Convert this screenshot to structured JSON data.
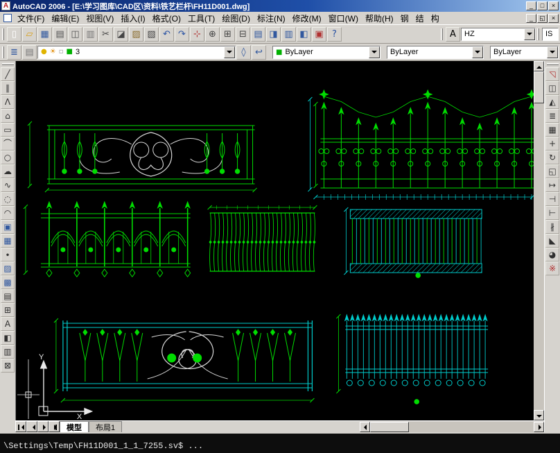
{
  "window": {
    "app_icon_glyph": "A",
    "title": "AutoCAD 2006 - [E:\\学习图库\\CAD区\\资料\\铁艺栏杆\\FH11D001.dwg]",
    "controls": {
      "minimize": "_",
      "maximize": "□",
      "close": "×"
    }
  },
  "menubar": {
    "items": [
      "文件(F)",
      "编辑(E)",
      "视图(V)",
      "插入(I)",
      "格式(O)",
      "工具(T)",
      "绘图(D)",
      "标注(N)",
      "修改(M)",
      "窗口(W)",
      "帮助(H)",
      "钢",
      "结",
      "构"
    ],
    "doc_controls": {
      "minimize": "_",
      "restore": "◱",
      "close": "×"
    }
  },
  "toolbar_standard": {
    "icons": [
      {
        "name": "qnew-icon",
        "glyph": "▯",
        "c": "#ffffff"
      },
      {
        "name": "open-icon",
        "glyph": "▱",
        "c": "#d8a018"
      },
      {
        "name": "save-icon",
        "glyph": "▦",
        "c": "#31589f"
      },
      {
        "name": "plot-icon",
        "glyph": "▤",
        "c": "#555555"
      },
      {
        "name": "plot-preview-icon",
        "glyph": "◫",
        "c": "#555555"
      },
      {
        "name": "publish-icon",
        "glyph": "▥",
        "c": "#777777"
      },
      {
        "name": "cut-icon",
        "glyph": "✂",
        "c": "#444444"
      },
      {
        "name": "copy-icon",
        "glyph": "◪",
        "c": "#444444"
      },
      {
        "name": "paste-icon",
        "glyph": "▨",
        "c": "#8a6d2f"
      },
      {
        "name": "match-properties-icon",
        "glyph": "▧",
        "c": "#444444"
      },
      {
        "name": "undo-icon",
        "glyph": "↶",
        "c": "#2952a3"
      },
      {
        "name": "redo-icon",
        "glyph": "↷",
        "c": "#2952a3"
      },
      {
        "name": "pan-icon",
        "glyph": "⊹",
        "c": "#b03030"
      },
      {
        "name": "zoom-realtime-icon",
        "glyph": "⊕",
        "c": "#444444"
      },
      {
        "name": "zoom-window-icon",
        "glyph": "⊞",
        "c": "#444444"
      },
      {
        "name": "zoom-previous-icon",
        "glyph": "⊟",
        "c": "#444444"
      },
      {
        "name": "properties-icon",
        "glyph": "▤",
        "c": "#31589f"
      },
      {
        "name": "designcenter-icon",
        "glyph": "◨",
        "c": "#31589f"
      },
      {
        "name": "tool-palettes-icon",
        "glyph": "▥",
        "c": "#31589f"
      },
      {
        "name": "sheet-set-manager-icon",
        "glyph": "◧",
        "c": "#31589f"
      },
      {
        "name": "markup-set-manager-icon",
        "glyph": "▣",
        "c": "#b03030"
      },
      {
        "name": "help-icon",
        "glyph": "?",
        "c": "#2952a3"
      }
    ],
    "text_style_icon": {
      "glyph": "A"
    },
    "text_style_combo": {
      "value": "HZ"
    },
    "right_partial_combo": {
      "value": "IS"
    }
  },
  "toolbar_properties": {
    "left_icons": [
      {
        "name": "layer-properties-manager-icon",
        "glyph": "≣",
        "c": "#31589f"
      },
      {
        "name": "layers-icon",
        "glyph": "▤",
        "c": "#777777"
      }
    ],
    "layer_combo": {
      "on_glyph": "●",
      "freeze_glyph": "☀",
      "lock_glyph": "▫",
      "color_chip": "■",
      "value": "3"
    },
    "mid_icons": [
      {
        "name": "make-object-layer-current-icon",
        "glyph": "◊",
        "c": "#31589f"
      },
      {
        "name": "layer-previous-icon",
        "glyph": "↩",
        "c": "#31589f"
      }
    ],
    "color_combo": {
      "chip": "■",
      "value": "ByLayer"
    },
    "linetype_combo": {
      "value": "ByLayer"
    },
    "lineweight_combo": {
      "value": "ByLayer"
    }
  },
  "draw_toolbar": {
    "icons": [
      {
        "name": "line-icon",
        "glyph": "╱",
        "c": "#303030"
      },
      {
        "name": "construction-line-icon",
        "glyph": "∥",
        "c": "#303030"
      },
      {
        "name": "polyline-icon",
        "glyph": "Λ",
        "c": "#303030"
      },
      {
        "name": "polygon-icon",
        "glyph": "⌂",
        "c": "#303030"
      },
      {
        "name": "rectangle-icon",
        "glyph": "▭",
        "c": "#303030"
      },
      {
        "name": "arc-icon",
        "glyph": "⌒",
        "c": "#303030"
      },
      {
        "name": "circle-icon",
        "glyph": "○",
        "c": "#303030"
      },
      {
        "name": "revision-cloud-icon",
        "glyph": "☁",
        "c": "#303030"
      },
      {
        "name": "spline-icon",
        "glyph": "∿",
        "c": "#303030"
      },
      {
        "name": "ellipse-icon",
        "glyph": "◌",
        "c": "#303030"
      },
      {
        "name": "ellipse-arc-icon",
        "glyph": "◠",
        "c": "#303030"
      },
      {
        "name": "insert-block-icon",
        "glyph": "▣",
        "c": "#31589f"
      },
      {
        "name": "make-block-icon",
        "glyph": "▦",
        "c": "#31589f"
      },
      {
        "name": "point-icon",
        "glyph": "∙",
        "c": "#303030"
      },
      {
        "name": "hatch-icon",
        "glyph": "▨",
        "c": "#31589f"
      },
      {
        "name": "gradient-icon",
        "glyph": "▩",
        "c": "#31589f"
      },
      {
        "name": "region-icon",
        "glyph": "▤",
        "c": "#303030"
      },
      {
        "name": "table-icon",
        "glyph": "⊞",
        "c": "#303030"
      },
      {
        "name": "multiline-text-icon",
        "glyph": "A",
        "c": "#303030"
      },
      {
        "name": "named-views-icon",
        "glyph": "◧",
        "c": "#303030"
      },
      {
        "name": "viewports-icon",
        "glyph": "▥",
        "c": "#303030"
      },
      {
        "name": "osnap-icon",
        "glyph": "⊠",
        "c": "#303030"
      }
    ]
  },
  "modify_toolbar": {
    "icons": [
      {
        "name": "erase-icon",
        "glyph": "◹",
        "c": "#b03030"
      },
      {
        "name": "copy-object-icon",
        "glyph": "◫",
        "c": "#303030"
      },
      {
        "name": "mirror-icon",
        "glyph": "◭",
        "c": "#303030"
      },
      {
        "name": "offset-icon",
        "glyph": "≣",
        "c": "#303030"
      },
      {
        "name": "array-icon",
        "glyph": "▦",
        "c": "#303030"
      },
      {
        "name": "move-icon",
        "glyph": "+",
        "c": "#303030"
      },
      {
        "name": "rotate-icon",
        "glyph": "↻",
        "c": "#303030"
      },
      {
        "name": "scale-icon",
        "glyph": "◱",
        "c": "#303030"
      },
      {
        "name": "stretch-icon",
        "glyph": "↦",
        "c": "#303030"
      },
      {
        "name": "trim-icon",
        "glyph": "⊣",
        "c": "#303030"
      },
      {
        "name": "extend-icon",
        "glyph": "⊢",
        "c": "#303030"
      },
      {
        "name": "break-icon",
        "glyph": "∦",
        "c": "#303030"
      },
      {
        "name": "chamfer-icon",
        "glyph": "◣",
        "c": "#303030"
      },
      {
        "name": "fillet-icon",
        "glyph": "◕",
        "c": "#303030"
      },
      {
        "name": "explode-icon",
        "glyph": "※",
        "c": "#b03030"
      }
    ]
  },
  "canvas": {
    "ucs": {
      "x_label": "X",
      "y_label": "Y"
    }
  },
  "tabs": {
    "model": "模型",
    "layout1": "布局1"
  },
  "command_line": {
    "text": "\\Settings\\Temp\\FH11D001_1_1_7255.sv$ ..."
  },
  "colors": {
    "green": "#00dd00",
    "cyan": "#00cccc",
    "white_ink": "#d8d8d8",
    "canvas_bg": "#000000",
    "chrome": "#d6d3ce",
    "title_start": "#0a246a",
    "title_end": "#a6caf0"
  }
}
